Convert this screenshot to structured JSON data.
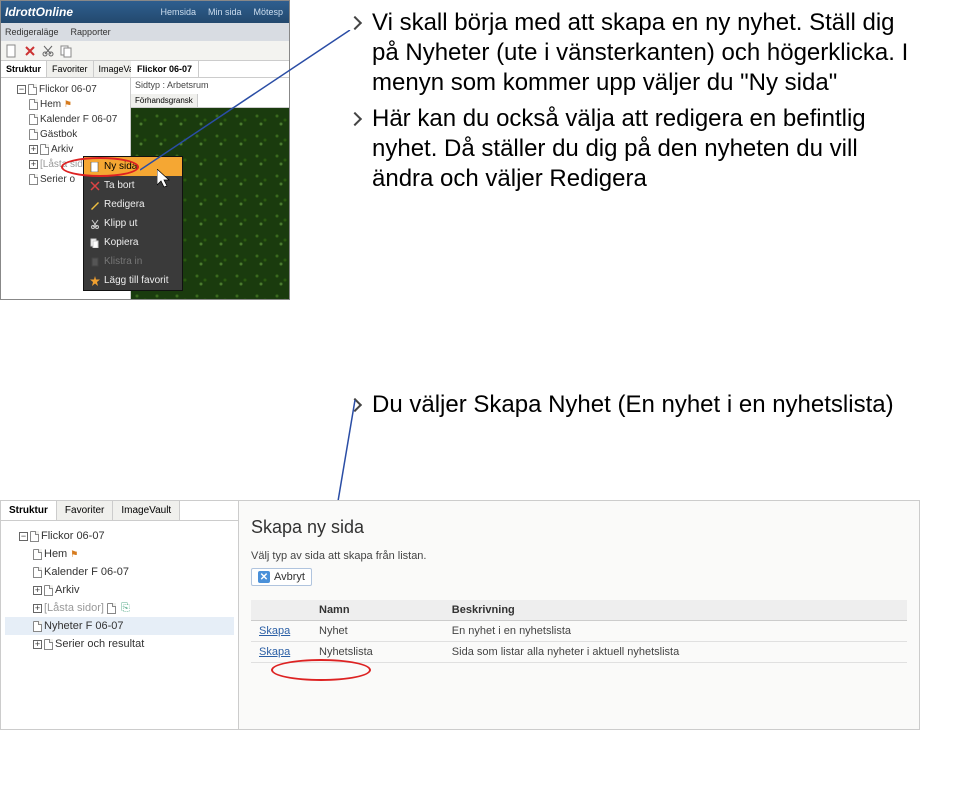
{
  "screenshot1": {
    "logo": "IdrottOnline",
    "top_tabs": [
      "Hemsida",
      "Min sida",
      "Mötesp"
    ],
    "subnav": [
      "Redigeraläge",
      "Rapporter"
    ],
    "left_tabs": [
      "Struktur",
      "Favoriter",
      "ImageVault"
    ],
    "tree": {
      "root": "Flickor 06-07",
      "items": [
        "Hem",
        "Kalender F 06-07",
        "Gästbok",
        "Arkiv",
        "[Låsta sidor]",
        "Serier o"
      ]
    },
    "right_tab": "Flickor 06-07",
    "sidtyp_label": "Sidtyp :",
    "sidtyp_value": "Arbetsrum",
    "preview_tab": "Förhandsgransk",
    "context_menu": {
      "items": [
        {
          "icon": "page",
          "label": "Ny sida",
          "hl": true
        },
        {
          "icon": "x",
          "label": "Ta bort"
        },
        {
          "icon": "pencil",
          "label": "Redigera"
        },
        {
          "icon": "cut",
          "label": "Klipp ut"
        },
        {
          "icon": "copy",
          "label": "Kopiera"
        },
        {
          "icon": "paste",
          "label": "Klistra in",
          "dis": true
        },
        {
          "icon": "star",
          "label": "Lägg till favorit"
        }
      ]
    }
  },
  "bullets1": [
    "Vi skall börja med att skapa en ny nyhet. Ställ dig på Nyheter (ute i vänsterkanten) och högerklicka. I menyn som kommer upp väljer du \"Ny sida\"",
    "Här kan du också välja att redigera en befintlig nyhet. Då ställer du dig på den nyheten du vill ändra och väljer Redigera"
  ],
  "bullets2": [
    "Du väljer Skapa Nyhet (En nyhet i en nyhetslista)"
  ],
  "screenshot2": {
    "left_tabs": [
      "Struktur",
      "Favoriter",
      "ImageVault"
    ],
    "tree": {
      "root": "Flickor 06-07",
      "items": [
        "Hem",
        "Kalender F 06-07",
        "Arkiv",
        "[Låsta sidor]",
        "Nyheter F 06-07",
        "Serier och resultat"
      ]
    },
    "title": "Skapa ny sida",
    "desc": "Välj typ av sida att skapa från listan.",
    "avbryt": "Avbryt",
    "table": {
      "headers": [
        "",
        "Namn",
        "Beskrivning"
      ],
      "rows": [
        {
          "link": "Skapa",
          "name": "Nyhet",
          "desc": "En nyhet i en nyhetslista"
        },
        {
          "link": "Skapa",
          "name": "Nyhetslista",
          "desc": "Sida som listar alla nyheter i aktuell nyhetslista"
        }
      ]
    }
  }
}
